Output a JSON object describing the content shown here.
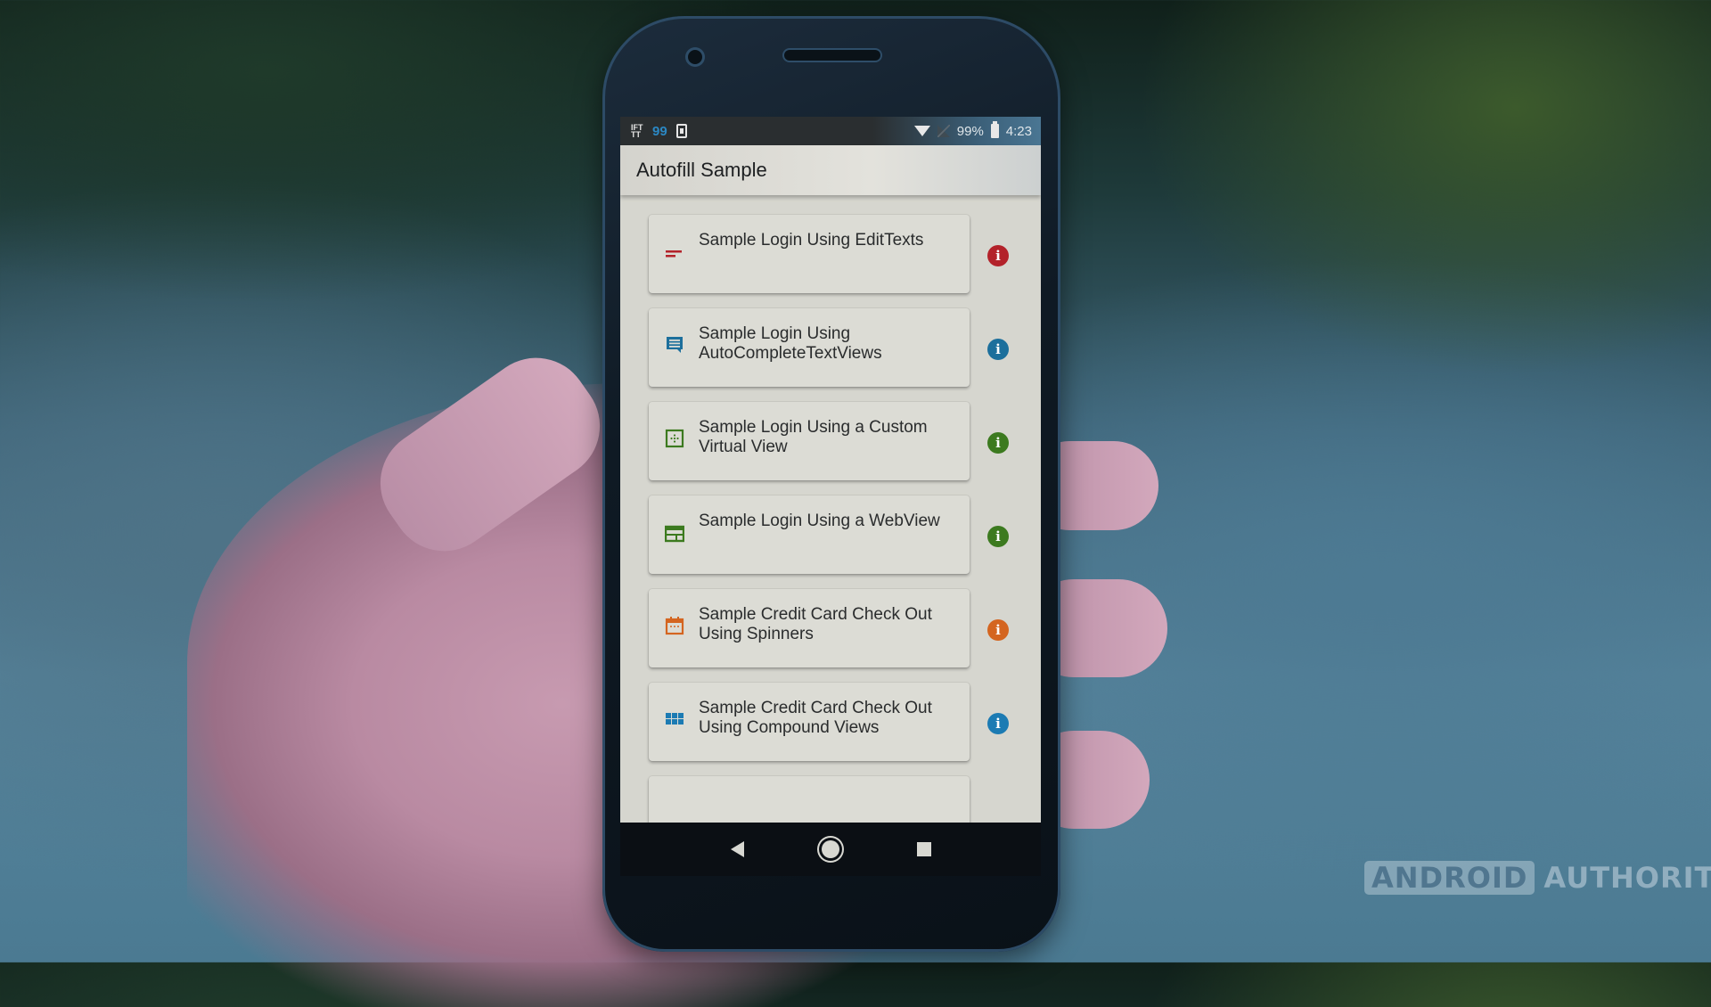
{
  "status_bar": {
    "notifications": [
      {
        "icon": "ifttt-icon",
        "text": "IFT TT"
      },
      {
        "icon": "count-badge",
        "text": "99"
      },
      {
        "icon": "download-icon"
      }
    ],
    "wifi_icon": "wifi-icon",
    "signal_icon": "no-signal-icon",
    "battery_percent": "99%",
    "time": "4:23"
  },
  "app_bar": {
    "title": "Autofill Sample"
  },
  "items": [
    {
      "label": "Sample Login Using EditTexts",
      "icon": "edittext-icon",
      "color": "#b3222a"
    },
    {
      "label": "Sample Login Using AutoCompleteTextViews",
      "icon": "chat-icon",
      "color": "#1c6f9c"
    },
    {
      "label": "Sample Login Using a Custom Virtual View",
      "icon": "virtual-view-icon",
      "color": "#3c7a1f"
    },
    {
      "label": "Sample Login Using a WebView",
      "icon": "webview-icon",
      "color": "#3c7a1f"
    },
    {
      "label": "Sample Credit Card Check Out Using Spinners",
      "icon": "calendar-icon",
      "color": "#d46520"
    },
    {
      "label": "Sample Credit Card Check Out Using Compound Views",
      "icon": "grid-icon",
      "color": "#1c7bb3"
    }
  ],
  "info_glyph": "i",
  "nav_bar": {
    "back": "back-icon",
    "home": "home-icon",
    "recents": "recents-icon"
  },
  "watermark": {
    "boxed": "ANDROID",
    "plain": "AUTHORITY"
  }
}
